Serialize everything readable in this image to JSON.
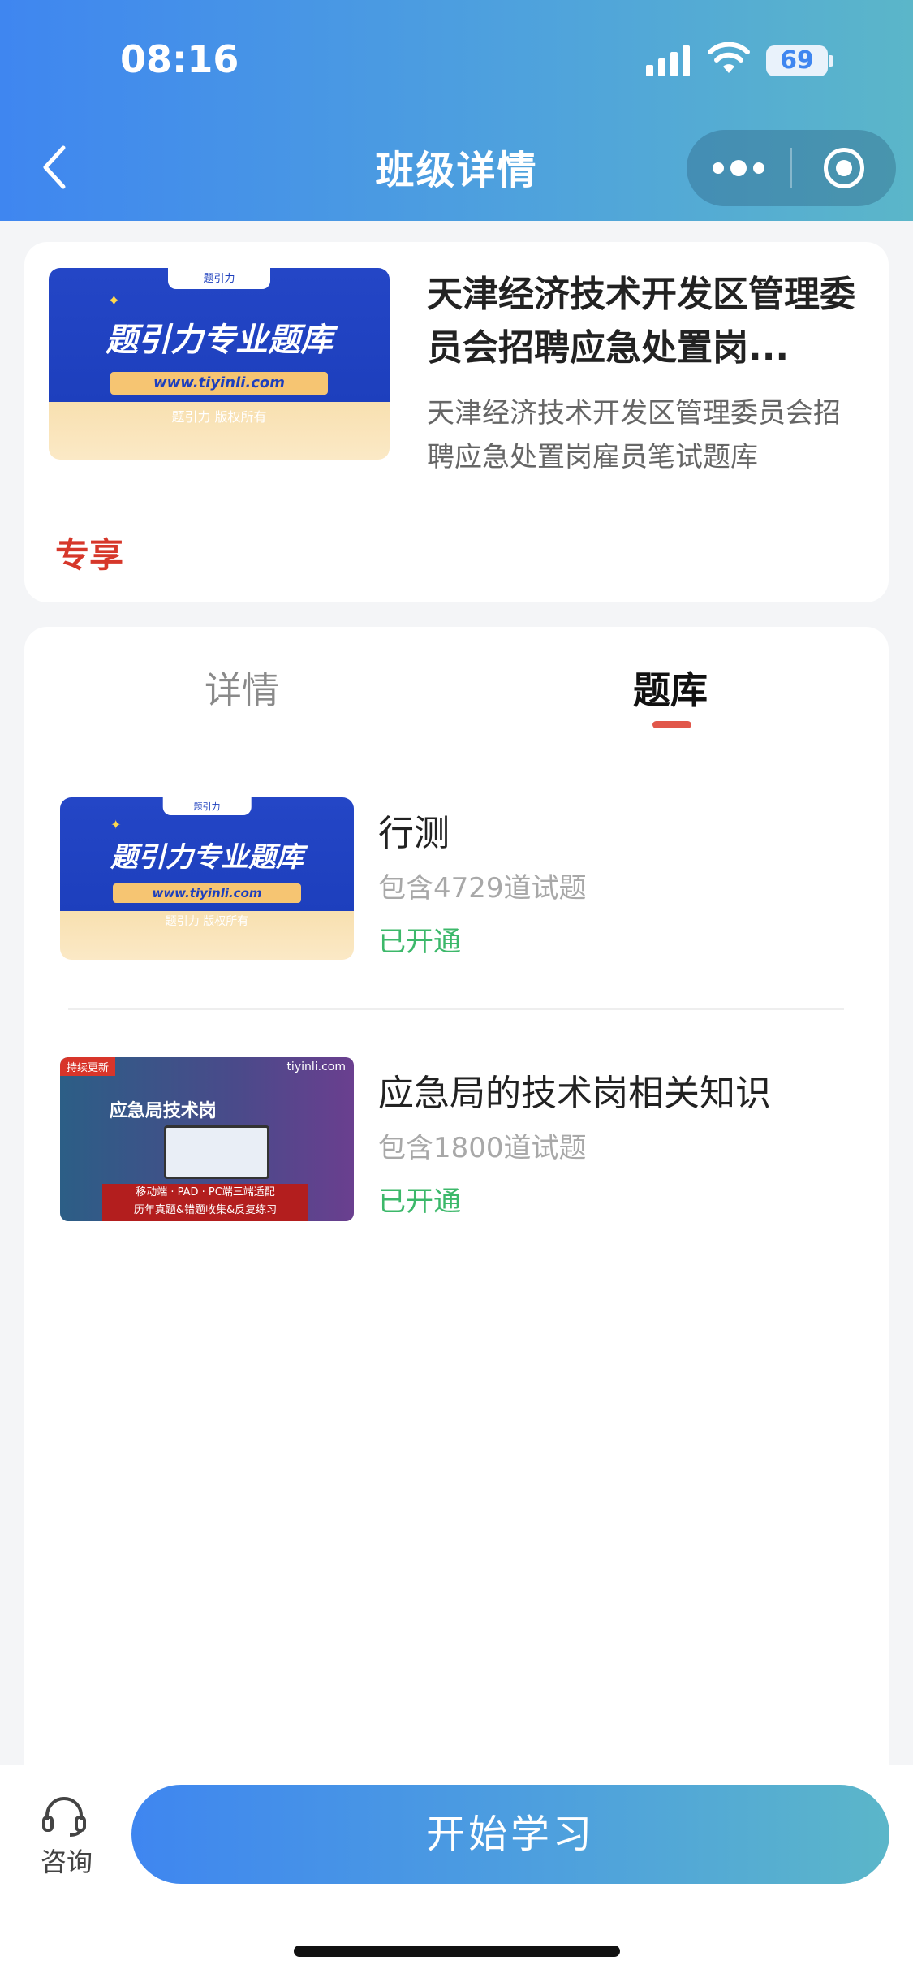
{
  "status_bar": {
    "time": "08:16",
    "battery": "69"
  },
  "nav": {
    "title": "班级详情"
  },
  "course": {
    "cover_brand": "题引力",
    "cover_title": "题引力专业题库",
    "cover_url": "www.tiyinli.com",
    "cover_copyright": "题引力 版权所有",
    "title": "天津经济技术开发区管理委员会招聘应急处置岗...",
    "description": "天津经济技术开发区管理委员会招聘应急处置岗雇员笔试题库",
    "badge": "专享"
  },
  "tabs": [
    {
      "label": "详情",
      "active": false
    },
    {
      "label": "题库",
      "active": true
    }
  ],
  "question_banks": [
    {
      "title": "行测",
      "count": "包含4729道试题",
      "status": "已开通",
      "cover": {
        "brand": "题引力",
        "title": "题引力专业题库",
        "url": "www.tiyinli.com",
        "copyright": "题引力 版权所有"
      }
    },
    {
      "title": "应急局的技术岗相关知识",
      "count": "包含1800道试题",
      "status": "已开通",
      "cover": {
        "tag": "持续更新",
        "brand": "tiyinli.com",
        "title": "应急局技术岗",
        "banner_line1": "移动端 · PAD · PC端三端适配",
        "banner_line2": "历年真题&错题收集&反复练习"
      }
    }
  ],
  "bottom": {
    "consult_label": "咨询",
    "start_label": "开始学习"
  },
  "colors": {
    "accent": "#3f86f0",
    "gradient_end": "#5bb6c9",
    "badge": "#d6372a",
    "status_open": "#3cb86a",
    "tab_indicator": "#e1574a"
  }
}
